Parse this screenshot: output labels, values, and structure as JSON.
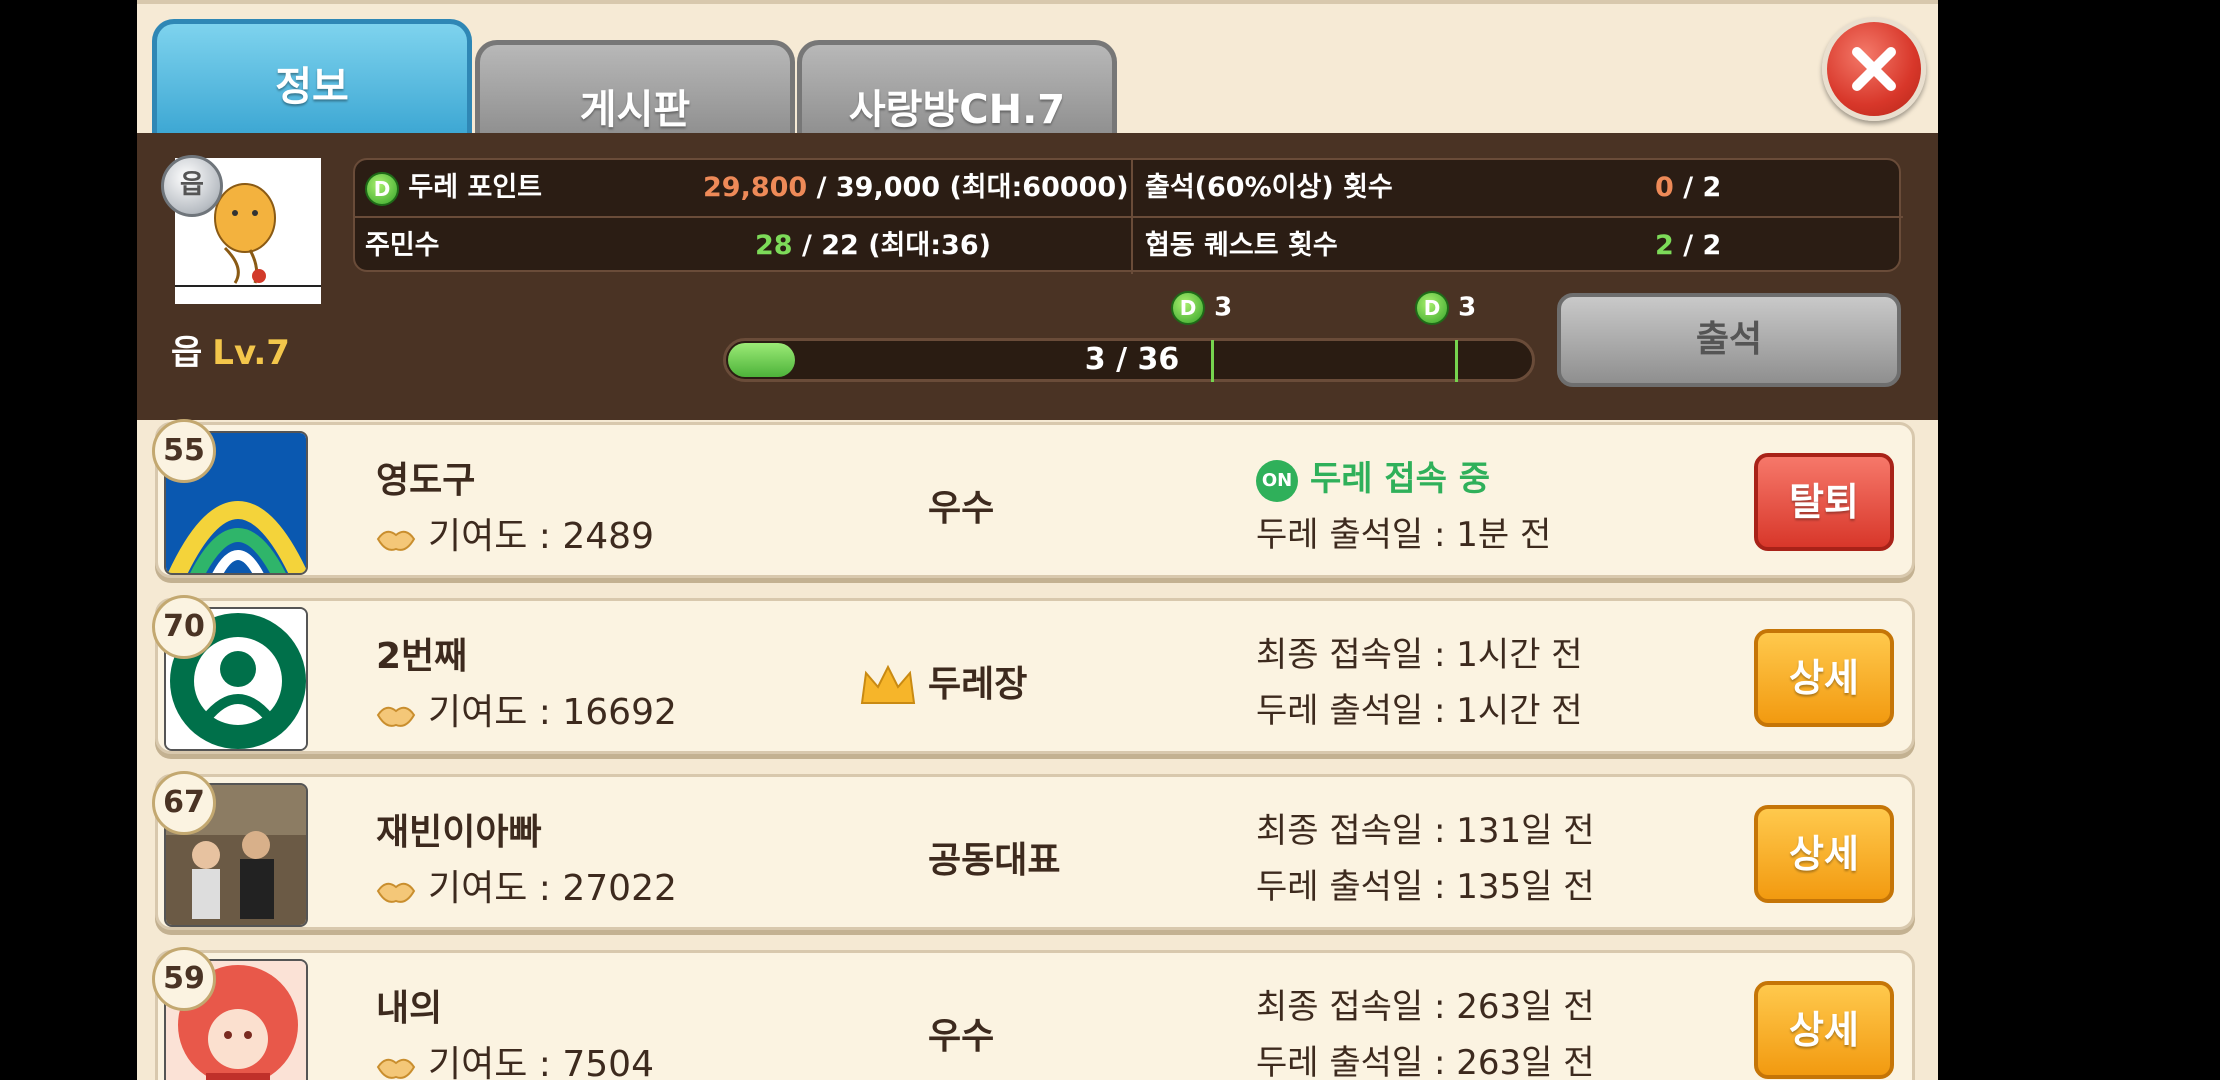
{
  "tabs": [
    {
      "label": "정보",
      "active": true
    },
    {
      "label": "게시판",
      "active": false
    },
    {
      "label": "사랑방CH.7",
      "active": false
    }
  ],
  "guild": {
    "grade_badge": "읍",
    "grade": "읍",
    "level": "Lv.7"
  },
  "stats": {
    "points_label": "두레 포인트",
    "points_current": "29,800",
    "points_rest": "/ 39,000 (최대:60000)",
    "members_label": "주민수",
    "members_current": "28",
    "members_rest": "/ 22 (최대:36)",
    "attendance_label": "출석(60%이상) 횟수",
    "attendance_current": "0",
    "attendance_rest": "/ 2",
    "coop_label": "협동 퀘스트 횟수",
    "coop_current": "2",
    "coop_rest": "/ 2",
    "d_icon": "D"
  },
  "progress": {
    "text": "3 / 36",
    "value": 3,
    "max": 36,
    "markers": [
      {
        "icon": "D",
        "reward": "3"
      },
      {
        "icon": "D",
        "reward": "3"
      }
    ]
  },
  "attend_button": "출석",
  "members": [
    {
      "level": "55",
      "name": "영도구",
      "contribution": "기여도 : 2489",
      "role": "우수",
      "status1": "두레 접속 중",
      "online": true,
      "online_icon": "ON",
      "status2": "두레 출석일 : 1분 전",
      "button": "탈퇴"
    },
    {
      "level": "70",
      "name": "2번째",
      "contribution": "기여도 : 16692",
      "role": "두레장",
      "status1": "최종 접속일 : 1시간 전",
      "online": false,
      "status2": "두레 출석일 : 1시간 전",
      "button": "상세"
    },
    {
      "level": "67",
      "name": "재빈이아빠",
      "contribution": "기여도 : 27022",
      "role": "공동대표",
      "status1": "최종 접속일 : 131일 전",
      "online": false,
      "status2": "두레 출석일 : 135일 전",
      "button": "상세"
    },
    {
      "level": "59",
      "name": "내의",
      "contribution": "기여도 : 7504",
      "role": "우수",
      "status1": "최종 접속일 : 263일 전",
      "online": false,
      "status2": "두레 출석일 : 263일 전",
      "button": "상세"
    }
  ],
  "colors": {
    "accent_blue": "#3aa5d2",
    "panel_brown": "#4a3324",
    "highlight_orange": "#ee8a58",
    "highlight_green": "#7ddb59",
    "online_green": "#2fb05a",
    "leave_red": "#d8372a",
    "detail_orange": "#f29a10"
  }
}
